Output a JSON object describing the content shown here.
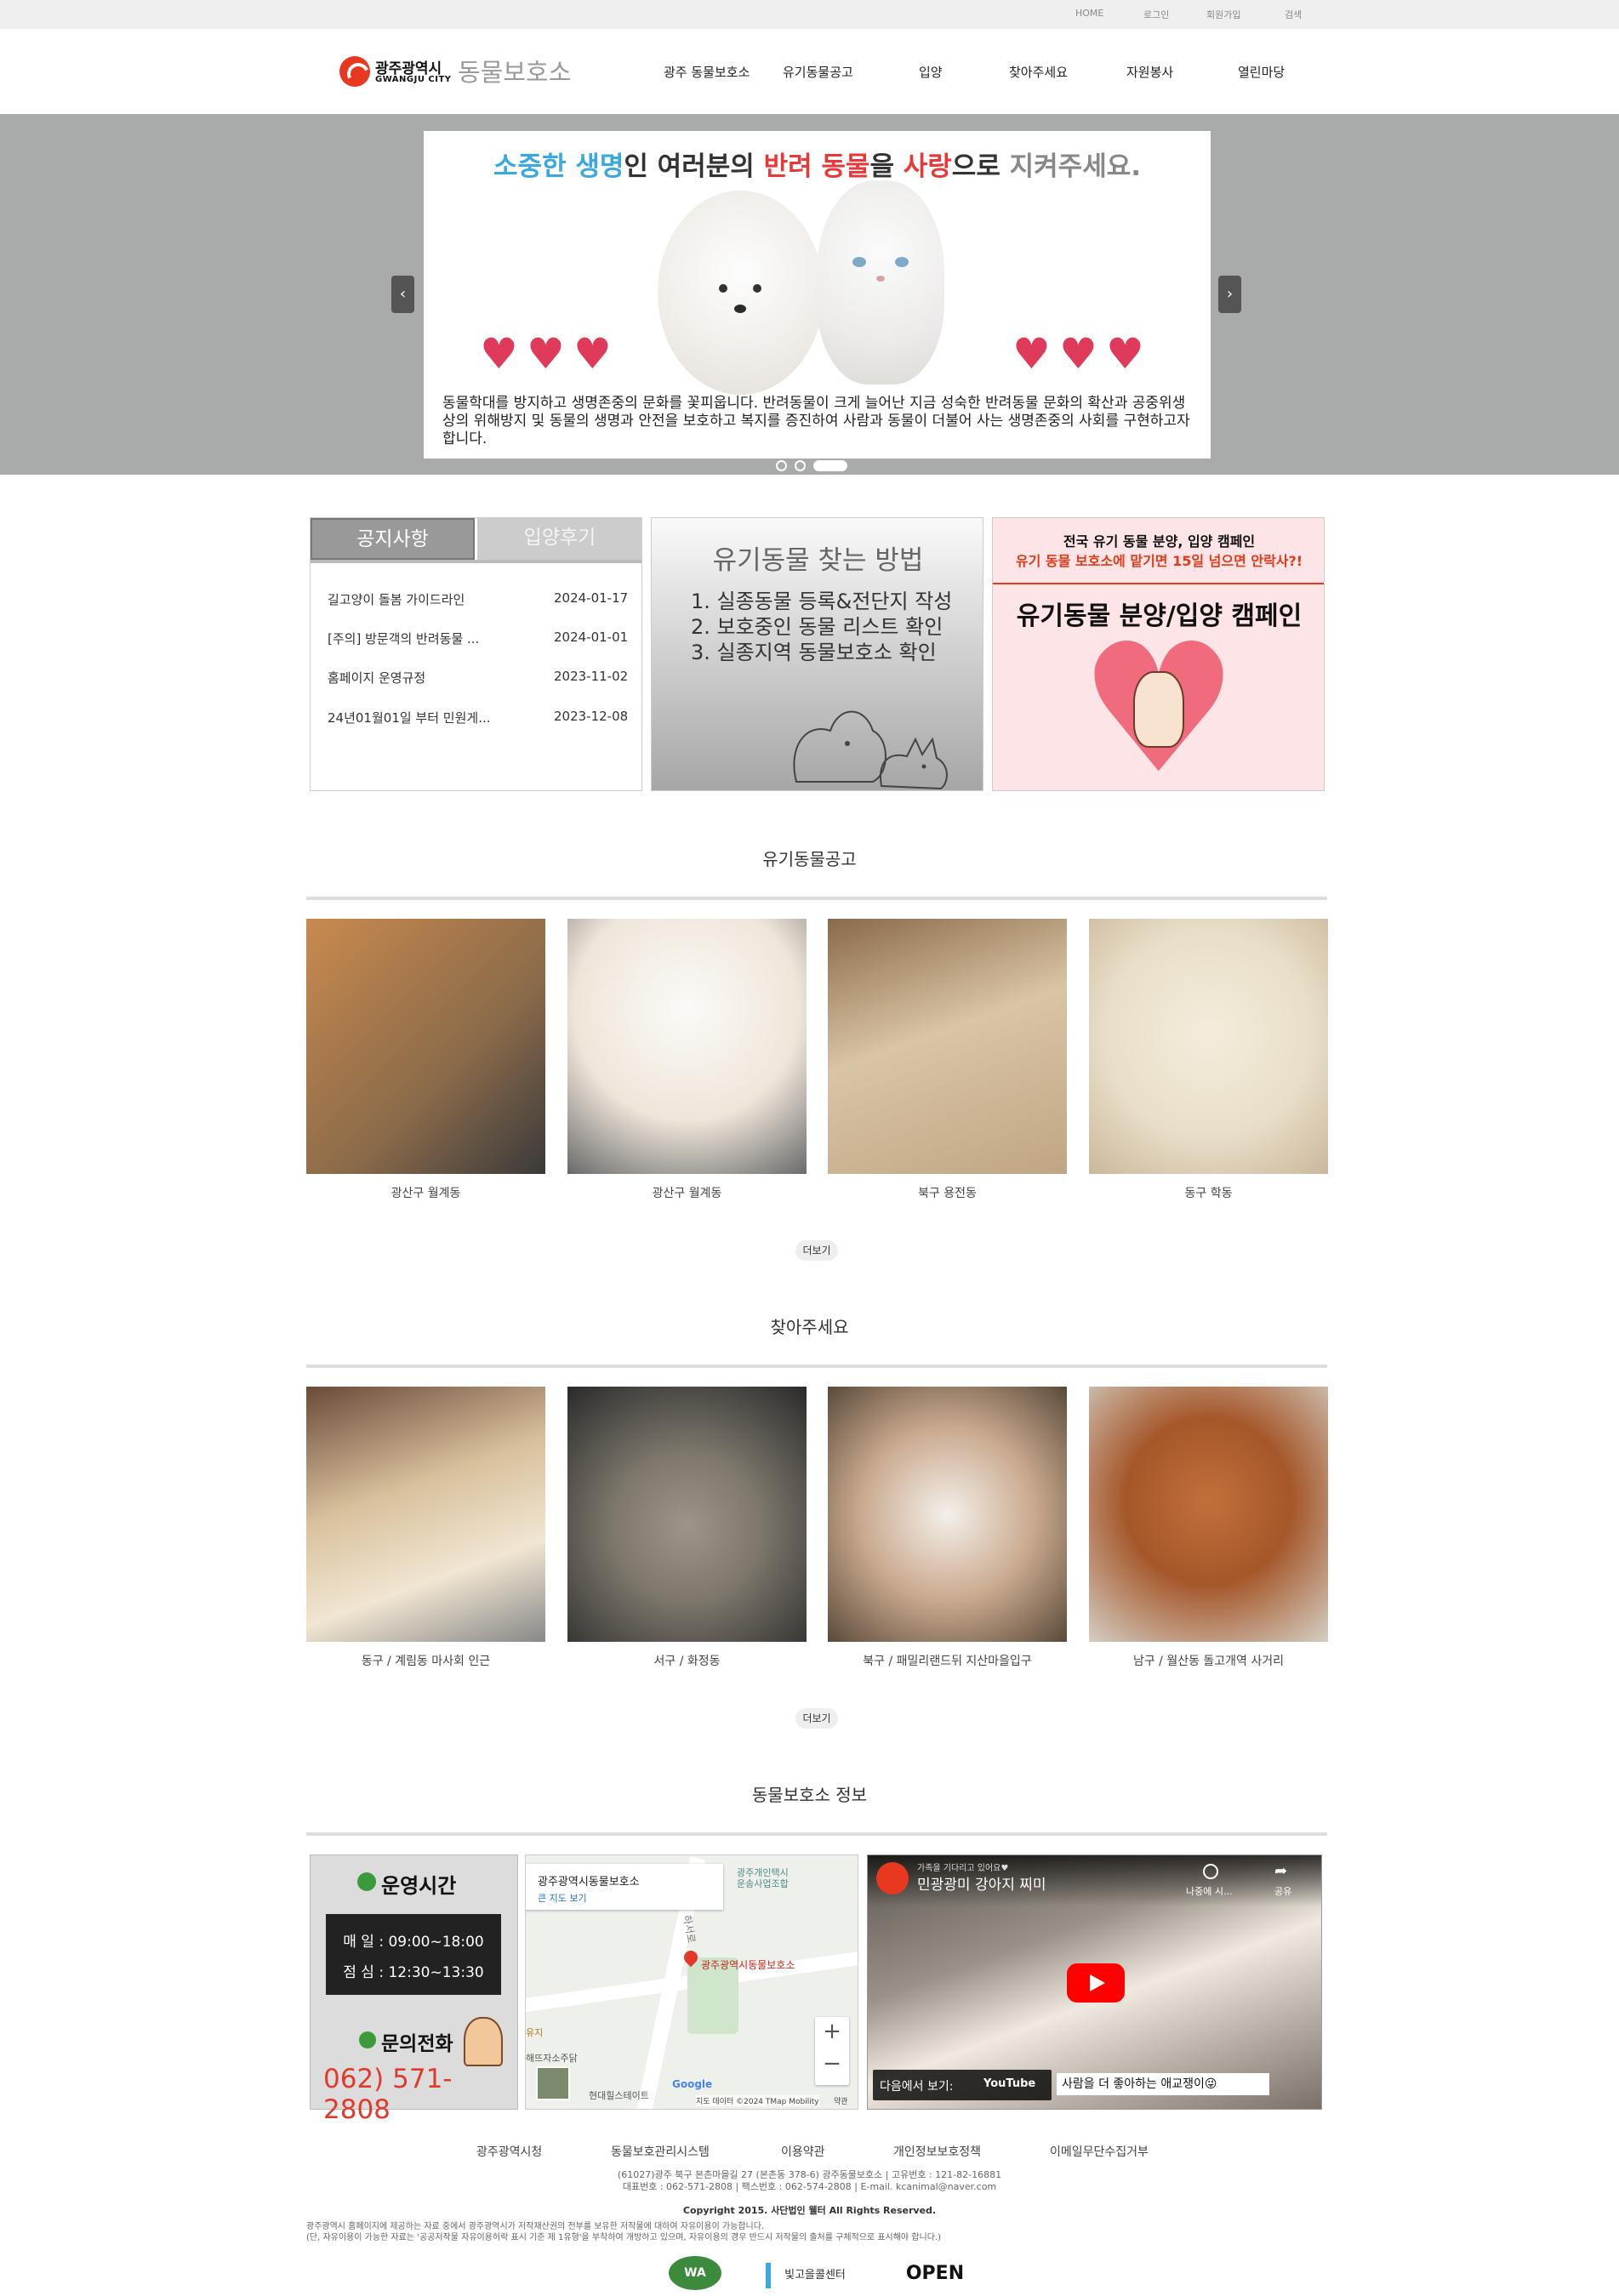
{
  "util": {
    "home": "HOME",
    "login": "로그인",
    "signup": "회원가입",
    "search": "검색"
  },
  "logo": {
    "city_ko": "광주광역시",
    "city_en": "GWANGJU CITY",
    "site": "동물보호소"
  },
  "nav": [
    "광주 동물보호소",
    "유기동물공고",
    "입양",
    "찾아주세요",
    "자원봉사",
    "열린마당"
  ],
  "banner": {
    "head_parts": [
      "소중한 생명",
      "인 여러분의 ",
      "반려 동물",
      "을 ",
      "사랑",
      "으로 ",
      "지켜주세요."
    ],
    "desc": "동물학대를 방지하고 생명존중의 문화를 꽃피웁니다. 반려동물이 크게 늘어난 지금 성숙한 반려동물 문화의 확산과 공중위생상의 위해방지 및 동물의 생명과 안전을 보호하고 복지를 증진하여 사람과 동물이 더불어 사는 생명존중의 사회를 구현하고자 합니다.",
    "prev": "‹",
    "next": "›"
  },
  "notice": {
    "tab_active": "공지사항",
    "tab_inactive": "입양후기",
    "rows": [
      {
        "title": "길고양이 돌봄 가이드라인",
        "date": "2024-01-17"
      },
      {
        "title": "[주의] 방문객의 반려동물 ...",
        "date": "2024-01-01"
      },
      {
        "title": "홈페이지 운영규정",
        "date": "2023-11-02"
      },
      {
        "title": "24년01월01일 부터 민원게...",
        "date": "2023-12-08"
      }
    ]
  },
  "find": {
    "title": "유기동물 찾는 방법",
    "steps": [
      "1. 실종동물 등록&전단지 작성",
      "2. 보호중인 동물 리스트 확인",
      "3. 실종지역 동물보호소 확인"
    ]
  },
  "campaign": {
    "line1": "전국 유기 동물 분양, 입양 캠페인",
    "line2": "유기 동물 보호소에 맡기면 15일 넘으면 안락사?!",
    "title": "유기동물 분양/입양 캠페인"
  },
  "stray": {
    "title": "유기동물공고",
    "items": [
      {
        "label": "광산구 월계동",
        "color": "#c98a4e"
      },
      {
        "label": "광산구 월계동",
        "color": "#efe6da"
      },
      {
        "label": "북구 용전동",
        "color": "#d9c4a6"
      },
      {
        "label": "동구 학동",
        "color": "#e9dfc8"
      }
    ],
    "more": "더보기"
  },
  "lost": {
    "title": "찾아주세요",
    "items": [
      {
        "label": "동구 / 계림동 마사회 인근",
        "color": "#d8c09c"
      },
      {
        "label": "서구 / 화정동",
        "color": "#7d776c"
      },
      {
        "label": "북구 / 패밀리랜드뒤 지산마을입구",
        "color": "#c9a98e"
      },
      {
        "label": "남구 / 월산동 돌고개역 사거리",
        "color": "#a5572a"
      }
    ],
    "more": "더보기"
  },
  "info": {
    "title": "동물보호소 정보",
    "hours_title": "운영시간",
    "hours": [
      "매 일 : 09:00~18:00",
      "점 심 : 12:30~13:30"
    ],
    "phone_title": "문의전화",
    "phone": "062) 571-2808",
    "map": {
      "place": "광주광역시동물보호소",
      "big_map": "큰 지도 보기",
      "marker_label": "광주광역시동물보호소",
      "poi1": "광주개인택시\n운송사업조합",
      "poi2": "유지",
      "poi3": "해뜨자소주닭",
      "poi4": "현대힐스테이트",
      "road": "하서로",
      "credit": "지도 데이터 ©2024 TMap Mobility",
      "terms": "약관",
      "google": "Google"
    },
    "video": {
      "channel": "가족을 기다리고 있어요♥",
      "title": "민광광미 강아지 찌미",
      "watch_later": "나중에 시...",
      "share": "공유",
      "watch_on": "다음에서 보기:",
      "youtube": "YouTube",
      "caption": "사람을 더 좋아하는 애교쟁이😜"
    }
  },
  "footer": {
    "links": [
      "광주광역시청",
      "동물보호관리시스템",
      "이용약관",
      "개인정보보호정책",
      "이메일무단수집거부"
    ],
    "address": "(61027)광주 북구 본촌마을길 27 (본촌동 378-6) 광주동물보호소  |  고유번호 : 121-82-16881",
    "contact": "대표번호 : 062-571-2808  |  팩스번호 : 062-574-2808  |  E-mail. kcanimal@naver.com",
    "copyright": "Copyright 2015. 사단법인 웰터 All Rights Reserved.",
    "notice1": "광주광역시 홈페이지에 제공하는 자료 중에서 광주광역시가 저작재산권의 전부를 보유한 저작물에 대하여 자유이용이 가능합니다.",
    "notice2": "(단, 자유이용이 가능한 자료는 '공공저작물 자유이용허락 표시 기준 제 1유형'을 부착하여 개방하고 있으며, 자유이용의 경우 반드시 저작물의 출처를 구체적으로 표시해야 합니다.)",
    "badge1": "WA",
    "badge2": "빛고을콜센터",
    "badge3": "OPEN"
  }
}
